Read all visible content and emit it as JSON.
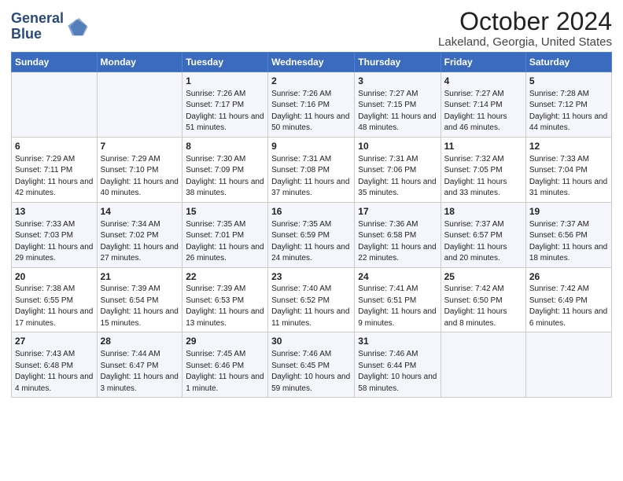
{
  "header": {
    "logo_line1": "General",
    "logo_line2": "Blue",
    "title": "October 2024",
    "subtitle": "Lakeland, Georgia, United States"
  },
  "weekdays": [
    "Sunday",
    "Monday",
    "Tuesday",
    "Wednesday",
    "Thursday",
    "Friday",
    "Saturday"
  ],
  "weeks": [
    [
      {
        "day": "",
        "sunrise": "",
        "sunset": "",
        "daylight": ""
      },
      {
        "day": "",
        "sunrise": "",
        "sunset": "",
        "daylight": ""
      },
      {
        "day": "1",
        "sunrise": "Sunrise: 7:26 AM",
        "sunset": "Sunset: 7:17 PM",
        "daylight": "Daylight: 11 hours and 51 minutes."
      },
      {
        "day": "2",
        "sunrise": "Sunrise: 7:26 AM",
        "sunset": "Sunset: 7:16 PM",
        "daylight": "Daylight: 11 hours and 50 minutes."
      },
      {
        "day": "3",
        "sunrise": "Sunrise: 7:27 AM",
        "sunset": "Sunset: 7:15 PM",
        "daylight": "Daylight: 11 hours and 48 minutes."
      },
      {
        "day": "4",
        "sunrise": "Sunrise: 7:27 AM",
        "sunset": "Sunset: 7:14 PM",
        "daylight": "Daylight: 11 hours and 46 minutes."
      },
      {
        "day": "5",
        "sunrise": "Sunrise: 7:28 AM",
        "sunset": "Sunset: 7:12 PM",
        "daylight": "Daylight: 11 hours and 44 minutes."
      }
    ],
    [
      {
        "day": "6",
        "sunrise": "Sunrise: 7:29 AM",
        "sunset": "Sunset: 7:11 PM",
        "daylight": "Daylight: 11 hours and 42 minutes."
      },
      {
        "day": "7",
        "sunrise": "Sunrise: 7:29 AM",
        "sunset": "Sunset: 7:10 PM",
        "daylight": "Daylight: 11 hours and 40 minutes."
      },
      {
        "day": "8",
        "sunrise": "Sunrise: 7:30 AM",
        "sunset": "Sunset: 7:09 PM",
        "daylight": "Daylight: 11 hours and 38 minutes."
      },
      {
        "day": "9",
        "sunrise": "Sunrise: 7:31 AM",
        "sunset": "Sunset: 7:08 PM",
        "daylight": "Daylight: 11 hours and 37 minutes."
      },
      {
        "day": "10",
        "sunrise": "Sunrise: 7:31 AM",
        "sunset": "Sunset: 7:06 PM",
        "daylight": "Daylight: 11 hours and 35 minutes."
      },
      {
        "day": "11",
        "sunrise": "Sunrise: 7:32 AM",
        "sunset": "Sunset: 7:05 PM",
        "daylight": "Daylight: 11 hours and 33 minutes."
      },
      {
        "day": "12",
        "sunrise": "Sunrise: 7:33 AM",
        "sunset": "Sunset: 7:04 PM",
        "daylight": "Daylight: 11 hours and 31 minutes."
      }
    ],
    [
      {
        "day": "13",
        "sunrise": "Sunrise: 7:33 AM",
        "sunset": "Sunset: 7:03 PM",
        "daylight": "Daylight: 11 hours and 29 minutes."
      },
      {
        "day": "14",
        "sunrise": "Sunrise: 7:34 AM",
        "sunset": "Sunset: 7:02 PM",
        "daylight": "Daylight: 11 hours and 27 minutes."
      },
      {
        "day": "15",
        "sunrise": "Sunrise: 7:35 AM",
        "sunset": "Sunset: 7:01 PM",
        "daylight": "Daylight: 11 hours and 26 minutes."
      },
      {
        "day": "16",
        "sunrise": "Sunrise: 7:35 AM",
        "sunset": "Sunset: 6:59 PM",
        "daylight": "Daylight: 11 hours and 24 minutes."
      },
      {
        "day": "17",
        "sunrise": "Sunrise: 7:36 AM",
        "sunset": "Sunset: 6:58 PM",
        "daylight": "Daylight: 11 hours and 22 minutes."
      },
      {
        "day": "18",
        "sunrise": "Sunrise: 7:37 AM",
        "sunset": "Sunset: 6:57 PM",
        "daylight": "Daylight: 11 hours and 20 minutes."
      },
      {
        "day": "19",
        "sunrise": "Sunrise: 7:37 AM",
        "sunset": "Sunset: 6:56 PM",
        "daylight": "Daylight: 11 hours and 18 minutes."
      }
    ],
    [
      {
        "day": "20",
        "sunrise": "Sunrise: 7:38 AM",
        "sunset": "Sunset: 6:55 PM",
        "daylight": "Daylight: 11 hours and 17 minutes."
      },
      {
        "day": "21",
        "sunrise": "Sunrise: 7:39 AM",
        "sunset": "Sunset: 6:54 PM",
        "daylight": "Daylight: 11 hours and 15 minutes."
      },
      {
        "day": "22",
        "sunrise": "Sunrise: 7:39 AM",
        "sunset": "Sunset: 6:53 PM",
        "daylight": "Daylight: 11 hours and 13 minutes."
      },
      {
        "day": "23",
        "sunrise": "Sunrise: 7:40 AM",
        "sunset": "Sunset: 6:52 PM",
        "daylight": "Daylight: 11 hours and 11 minutes."
      },
      {
        "day": "24",
        "sunrise": "Sunrise: 7:41 AM",
        "sunset": "Sunset: 6:51 PM",
        "daylight": "Daylight: 11 hours and 9 minutes."
      },
      {
        "day": "25",
        "sunrise": "Sunrise: 7:42 AM",
        "sunset": "Sunset: 6:50 PM",
        "daylight": "Daylight: 11 hours and 8 minutes."
      },
      {
        "day": "26",
        "sunrise": "Sunrise: 7:42 AM",
        "sunset": "Sunset: 6:49 PM",
        "daylight": "Daylight: 11 hours and 6 minutes."
      }
    ],
    [
      {
        "day": "27",
        "sunrise": "Sunrise: 7:43 AM",
        "sunset": "Sunset: 6:48 PM",
        "daylight": "Daylight: 11 hours and 4 minutes."
      },
      {
        "day": "28",
        "sunrise": "Sunrise: 7:44 AM",
        "sunset": "Sunset: 6:47 PM",
        "daylight": "Daylight: 11 hours and 3 minutes."
      },
      {
        "day": "29",
        "sunrise": "Sunrise: 7:45 AM",
        "sunset": "Sunset: 6:46 PM",
        "daylight": "Daylight: 11 hours and 1 minute."
      },
      {
        "day": "30",
        "sunrise": "Sunrise: 7:46 AM",
        "sunset": "Sunset: 6:45 PM",
        "daylight": "Daylight: 10 hours and 59 minutes."
      },
      {
        "day": "31",
        "sunrise": "Sunrise: 7:46 AM",
        "sunset": "Sunset: 6:44 PM",
        "daylight": "Daylight: 10 hours and 58 minutes."
      },
      {
        "day": "",
        "sunrise": "",
        "sunset": "",
        "daylight": ""
      },
      {
        "day": "",
        "sunrise": "",
        "sunset": "",
        "daylight": ""
      }
    ]
  ]
}
